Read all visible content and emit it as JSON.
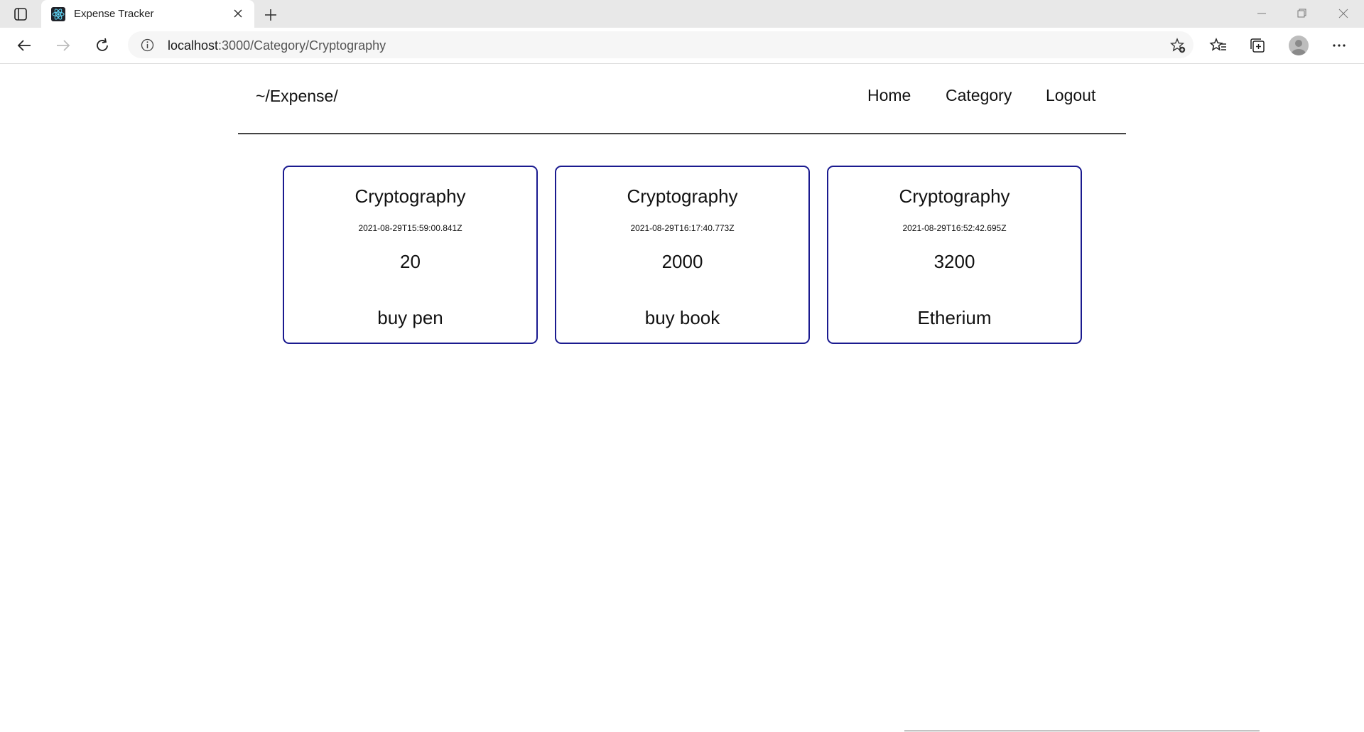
{
  "browser": {
    "tab": {
      "title": "Expense Tracker"
    },
    "address": {
      "host": "localhost",
      "path": ":3000/Category/Cryptography"
    }
  },
  "header": {
    "brand": "~/Expense/",
    "nav": [
      "Home",
      "Category",
      "Logout"
    ]
  },
  "expenses": [
    {
      "category": "Cryptography",
      "date": "2021-08-29T15:59:00.841Z",
      "amount": "20",
      "description": "buy pen"
    },
    {
      "category": "Cryptography",
      "date": "2021-08-29T16:17:40.773Z",
      "amount": "2000",
      "description": "buy book"
    },
    {
      "category": "Cryptography",
      "date": "2021-08-29T16:52:42.695Z",
      "amount": "3200",
      "description": "Etherium"
    }
  ],
  "colors": {
    "card_border": "#1a1a8f",
    "divider": "#444444",
    "titlebar": "#e8e8e8"
  },
  "icons": [
    "tab-actions-icon",
    "react-favicon-icon",
    "close-icon",
    "plus-icon",
    "minimize-icon",
    "restore-icon",
    "back-icon",
    "forward-icon",
    "refresh-icon",
    "info-icon",
    "add-favorite-icon",
    "favorites-icon",
    "collections-icon",
    "profile-icon",
    "more-icon"
  ]
}
